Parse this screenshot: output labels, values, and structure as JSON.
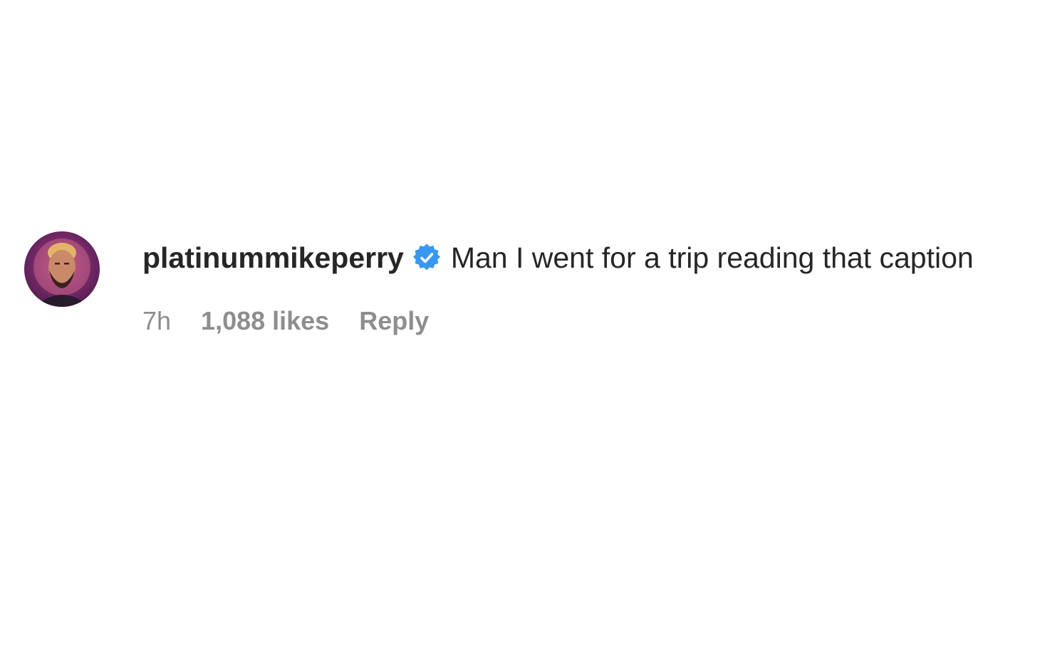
{
  "comment": {
    "username": "platinummikeperry",
    "verified": true,
    "text": "Man I went for a trip reading that caption",
    "timestamp": "7h",
    "likes": "1,088 likes",
    "reply_label": "Reply"
  },
  "icons": {
    "verified": "verified-badge-icon",
    "avatar": "profile-avatar"
  },
  "colors": {
    "verified_blue": "#3897f0",
    "text_primary": "#262626",
    "text_secondary": "#8e8e8e"
  }
}
